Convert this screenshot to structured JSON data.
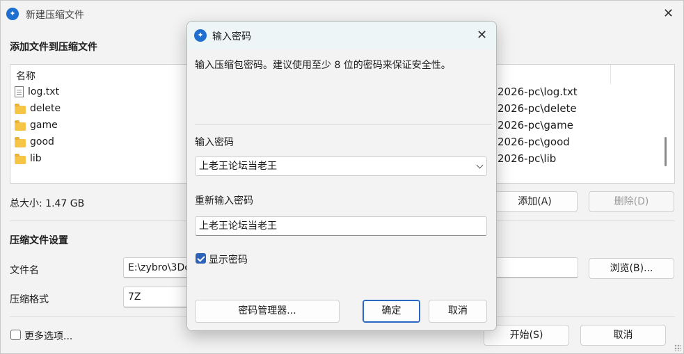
{
  "window": {
    "title": "新建压缩文件",
    "section_files": "添加文件到压缩文件",
    "column_name": "名称",
    "files": [
      {
        "name": "log.txt",
        "icon": "text-file-icon",
        "path": "2026-pc\\log.txt"
      },
      {
        "name": "delete",
        "icon": "folder-icon",
        "path": "2026-pc\\delete"
      },
      {
        "name": "game",
        "icon": "folder-icon",
        "path": "2026-pc\\game"
      },
      {
        "name": "good",
        "icon": "folder-icon",
        "path": "2026-pc\\good"
      },
      {
        "name": "lib",
        "icon": "folder-icon",
        "path": "2026-pc\\lib"
      }
    ],
    "total_size": "总大小: 1.47 GB",
    "add_button": "添加(A)",
    "remove_button": "删除(D)",
    "section_settings": "压缩文件设置",
    "filename_label": "文件名",
    "filename_value": "E:\\zybro\\3Dc",
    "browse_button": "浏览(B)...",
    "format_label": "压缩格式",
    "format_value": "7Z",
    "more_options": "更多选项...",
    "start_button": "开始(S)",
    "cancel_button": "取消"
  },
  "dialog": {
    "title": "输入密码",
    "description": "输入压缩包密码。建议使用至少 8 位的密码来保证安全性。",
    "password_label": "输入密码",
    "password_value": "上老王论坛当老王",
    "confirm_label": "重新输入密码",
    "confirm_value": "上老王论坛当老王",
    "show_password": "显示密码",
    "show_password_checked": true,
    "manager_button": "密码管理器...",
    "ok_button": "确定",
    "cancel_button": "取消"
  },
  "colors": {
    "accent": "#2c62b8",
    "dialog_title_bg": "#eef5f7"
  }
}
